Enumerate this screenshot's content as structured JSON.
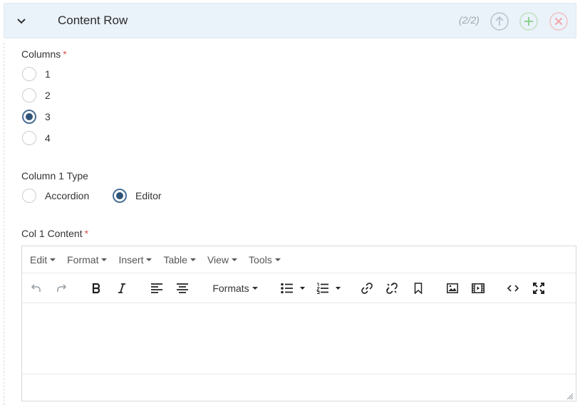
{
  "header": {
    "title": "Content Row",
    "counter": "(2/2)",
    "colors": {
      "up": "#b9c3cd",
      "add": "#8fd08f",
      "remove": "#f0a7a7"
    }
  },
  "columns": {
    "label": "Columns",
    "required_mark": "*",
    "options": [
      "1",
      "2",
      "3",
      "4"
    ],
    "selected": "3"
  },
  "column1_type": {
    "label": "Column 1 Type",
    "options": [
      "Accordion",
      "Editor"
    ],
    "selected": "Editor"
  },
  "col1_content": {
    "label": "Col 1 Content",
    "required_mark": "*",
    "menubar": [
      "Edit",
      "Format",
      "Insert",
      "Table",
      "View",
      "Tools"
    ],
    "toolbar": {
      "formats_label": "Formats",
      "icons": [
        "undo-icon",
        "redo-icon",
        "bold-icon",
        "italic-icon",
        "align-left-icon",
        "align-center-icon",
        "bullet-list-icon",
        "numbered-list-icon",
        "link-icon",
        "unlink-icon",
        "bookmark-icon",
        "image-icon",
        "media-icon",
        "code-icon",
        "fullscreen-icon"
      ]
    },
    "value": ""
  }
}
